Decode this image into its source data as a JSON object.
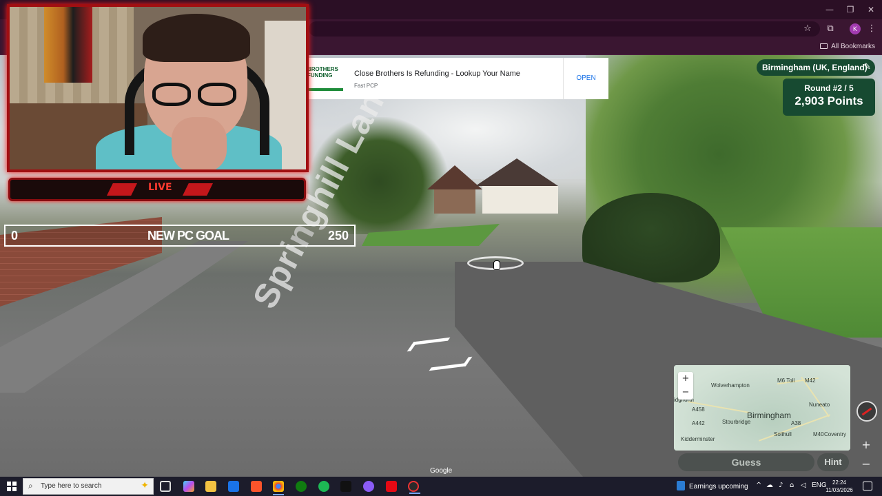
{
  "browser": {
    "window_controls": {
      "minimize": "—",
      "restore": "❐",
      "close": "✕"
    },
    "toolbar": {
      "profile_initial": "K"
    },
    "bookmarks": {
      "all_bookmarks": "All Bookmarks"
    }
  },
  "ad": {
    "brand_text": "BROTHERS FUNDING",
    "title": "Close Brothers Is Refunding - Lookup Your Name",
    "subtitle": "Fast PCP",
    "cta": "OPEN"
  },
  "stream_overlay": {
    "live_label": "LIVE",
    "goal": {
      "min": "0",
      "label": "NEW PC GOAL",
      "max": "250"
    }
  },
  "game": {
    "location": "Birmingham (UK, England)",
    "round": "Round #2 / 5",
    "points": "2,903 Points",
    "guess_label": "Guess",
    "hint_label": "Hint",
    "map_zoom_in": "+",
    "map_zoom_out": "−",
    "street_name": "Springhill Lane",
    "attribution": "Google",
    "minimap_labels": {
      "wolverhampton": "Wolverhampton",
      "birmingham": "Birmingham",
      "stourbridge": "Stourbridge",
      "solihull": "Solihull",
      "kidderminster": "Kidderminster",
      "coventry": "Coventry",
      "nuneaton": "Nuneato",
      "bridgnorth": "idgnorth",
      "m6_toll": "M6 Toll",
      "m42": "M42",
      "a458": "A458",
      "a442": "A442",
      "m40": "M40",
      "a38": "A38"
    },
    "sv_zoom_in": "+",
    "sv_zoom_out": "−"
  },
  "taskbar": {
    "search_placeholder": "Type here to search",
    "news": "Earnings upcoming",
    "language": "ENG",
    "time": "22:24",
    "date": "11/03/2026"
  }
}
